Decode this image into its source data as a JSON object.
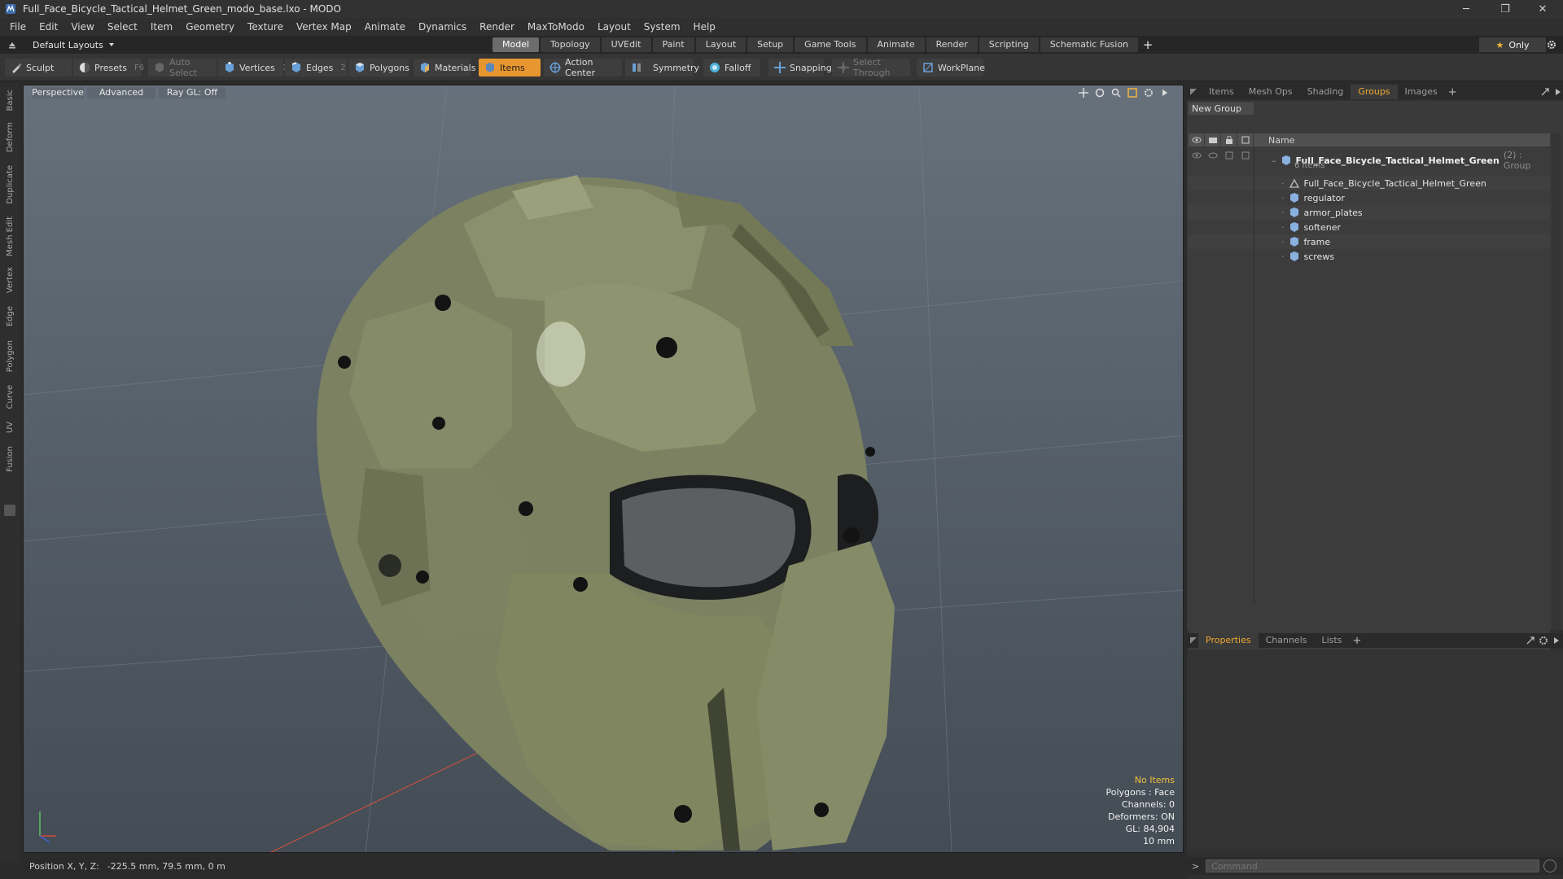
{
  "window": {
    "title": "Full_Face_Bicycle_Tactical_Helmet_Green_modo_base.lxo - MODO",
    "controls": {
      "minimize": "─",
      "restore": "❐",
      "close": "✕"
    }
  },
  "menu": [
    "File",
    "Edit",
    "View",
    "Select",
    "Item",
    "Geometry",
    "Texture",
    "Vertex Map",
    "Animate",
    "Dynamics",
    "Render",
    "MaxToModo",
    "Layout",
    "System",
    "Help"
  ],
  "layout": {
    "selector_label": "Default Layouts",
    "tabs": [
      "Model",
      "Topology",
      "UVEdit",
      "Paint",
      "Layout",
      "Setup",
      "Game Tools",
      "Animate",
      "Render",
      "Scripting",
      "Schematic Fusion"
    ],
    "active_tab": "Model",
    "plus": "+",
    "only_label": "Only"
  },
  "toolbar": {
    "sculpt": "Sculpt",
    "presets": "Presets",
    "presets_hotkey": "F6",
    "auto_select": "Auto Select",
    "vertices": "Vertices",
    "vertices_hotkey": "1",
    "edges": "Edges",
    "edges_hotkey": "2",
    "polygons": "Polygons",
    "materials": "Materials",
    "items": "Items",
    "action_center": "Action Center",
    "symmetry": "Symmetry",
    "falloff": "Falloff",
    "snapping": "Snapping",
    "select_through": "Select Through",
    "workplane": "WorkPlane"
  },
  "left_tabs": [
    "Basic",
    "Deform",
    "Duplicate",
    "Mesh Edit",
    "Vertex",
    "Edge",
    "Polygon",
    "Curve",
    "UV",
    "Fusion"
  ],
  "viewport": {
    "view_label": "Perspective",
    "shading_label": "Advanced",
    "raygl_label": "Ray GL: Off",
    "stats": {
      "selection": "No Items",
      "polygons": "Polygons : Face",
      "channels": "Channels: 0",
      "deformers": "Deformers: ON",
      "gl": "GL: 84,904",
      "scale": "10 mm"
    },
    "colors": {
      "helmet": "#7a8060",
      "helmet_shadow": "#4c5038",
      "visor": "#1a1c1e",
      "bg_top": "#66717c",
      "bg_bottom": "#444c55"
    }
  },
  "status": {
    "position_label": "Position X, Y, Z:",
    "position_value": "-225.5 mm, 79.5 mm, 0 m"
  },
  "groups_panel": {
    "tabs": [
      "Items",
      "Mesh Ops",
      "Shading",
      "Groups",
      "Images"
    ],
    "active_tab": "Groups",
    "new_group": "New Group",
    "name_header": "Name",
    "root": {
      "name": "Full_Face_Bicycle_Tactical_Helmet_Green",
      "count_tag": "(2) : Group",
      "items_count": "6 Items"
    },
    "children": [
      "Full_Face_Bicycle_Tactical_Helmet_Green",
      "regulator",
      "armor_plates",
      "softener",
      "frame",
      "screws"
    ]
  },
  "properties_panel": {
    "tabs": [
      "Properties",
      "Channels",
      "Lists"
    ],
    "active_tab": "Properties"
  },
  "command": {
    "prompt": ">",
    "placeholder": "Command"
  },
  "accent_color": "#e8962f"
}
